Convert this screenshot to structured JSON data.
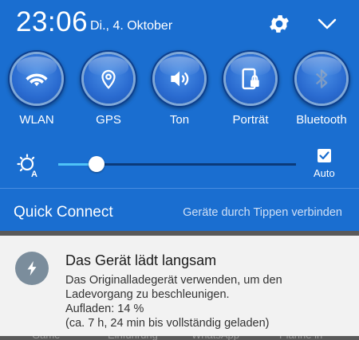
{
  "status": {
    "time": "23:06",
    "date": "Di., 4. Oktober"
  },
  "header": {
    "settings_icon": "gear-icon",
    "collapse_icon": "chevron-down-icon"
  },
  "toggles": [
    {
      "label": "WLAN",
      "icon": "wifi-icon"
    },
    {
      "label": "GPS",
      "icon": "location-pin-icon"
    },
    {
      "label": "Ton",
      "icon": "speaker-icon"
    },
    {
      "label": "Porträt",
      "icon": "portrait-lock-icon"
    },
    {
      "label": "Bluetooth",
      "icon": "bluetooth-icon"
    }
  ],
  "brightness": {
    "icon": "auto-brightness-icon",
    "level": 0.16,
    "auto_checked": true,
    "auto_label": "Auto"
  },
  "quick_connect": {
    "title": "Quick Connect",
    "hint": "Geräte durch Tippen verbinden"
  },
  "notification": {
    "icon": "lightning-icon",
    "title": "Das Gerät lädt langsam",
    "lines": [
      "Das Originalladegerät verwenden, um den",
      "Ladevorgang zu beschleunigen.",
      "Aufladen: 14 %",
      "(ca. 7 h, 24 min bis vollständig geladen)"
    ]
  },
  "background_app": {
    "items": [
      "Game",
      "Einführung",
      "WhatsApp",
      "Planne in"
    ]
  },
  "colors": {
    "panel_blue": "#1a6ed0",
    "slider_accent": "#4fc3f7",
    "card_bg": "#f2f2f2"
  }
}
